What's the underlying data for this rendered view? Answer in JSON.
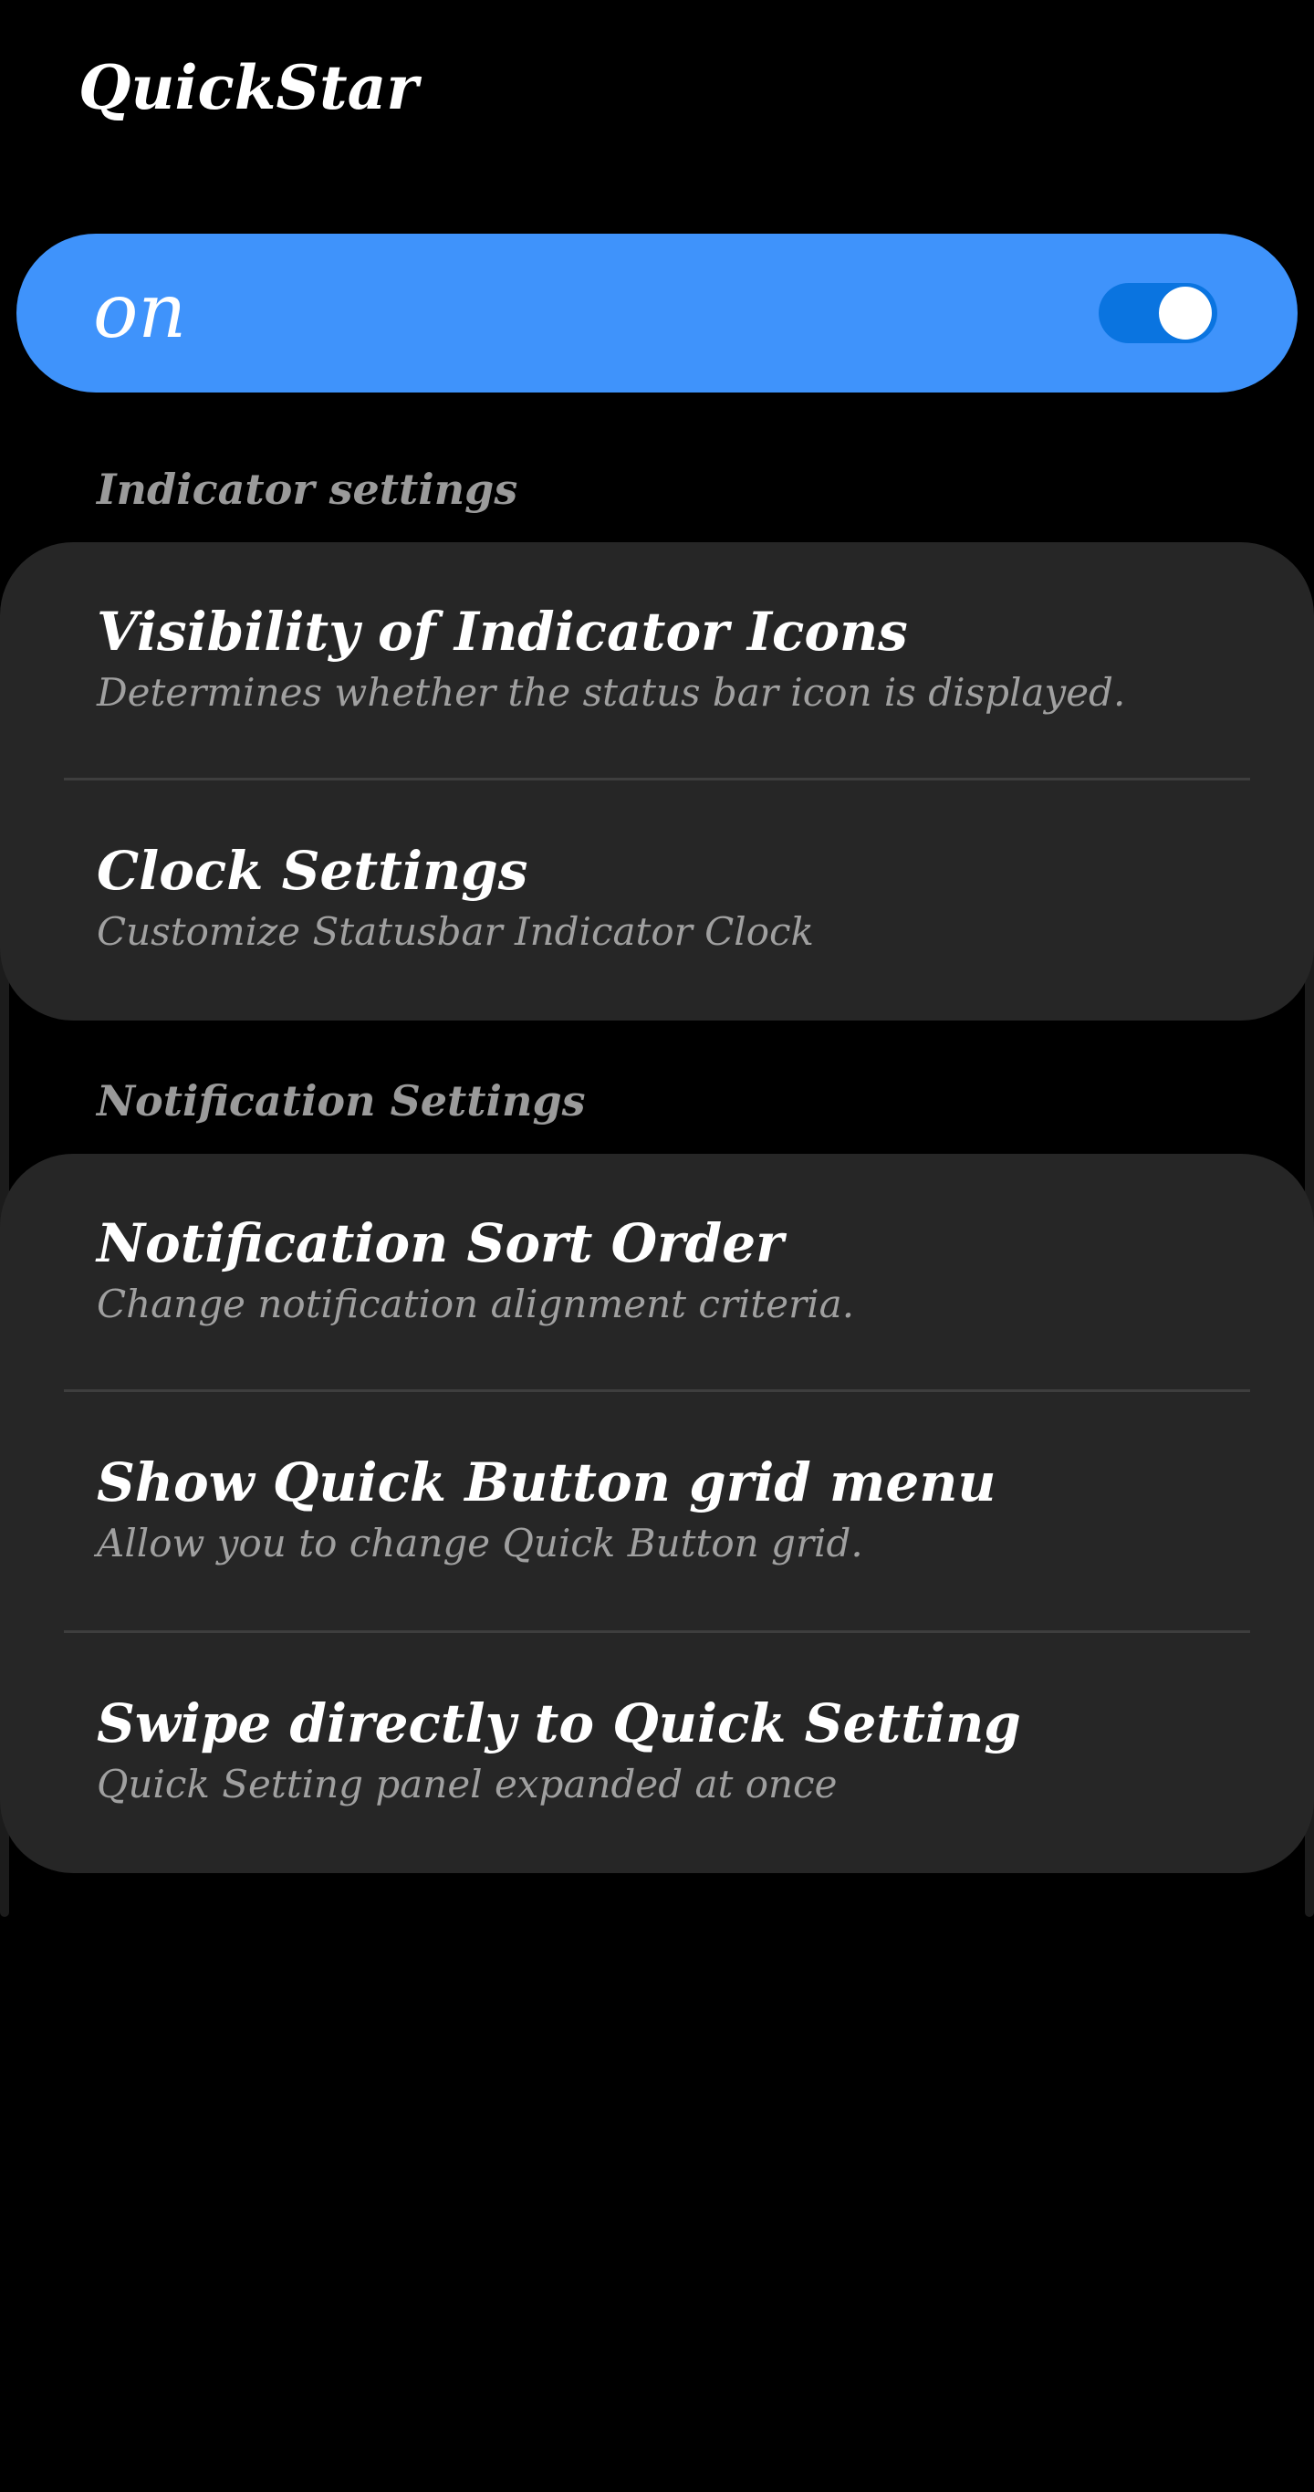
{
  "app": {
    "title": "QuickStar"
  },
  "master_switch": {
    "label": "on",
    "enabled": true,
    "color": "#3f93fb",
    "toggle_track_color": "#0a74e0"
  },
  "sections": [
    {
      "header": "Indicator settings",
      "items": [
        {
          "title": "Visibility of Indicator Icons",
          "subtitle": "Determines whether the status bar icon is displayed."
        },
        {
          "title": "Clock Settings",
          "subtitle": "Customize Statusbar Indicator Clock"
        }
      ]
    },
    {
      "header": "Notification Settings",
      "items": [
        {
          "title": "Notification Sort Order",
          "subtitle": "Change notification alignment criteria."
        },
        {
          "title": "Show Quick Button grid menu",
          "subtitle": "Allow you to change Quick Button grid."
        },
        {
          "title": "Swipe directly to Quick Setting",
          "subtitle": "Quick Setting panel expanded at once"
        }
      ]
    }
  ]
}
